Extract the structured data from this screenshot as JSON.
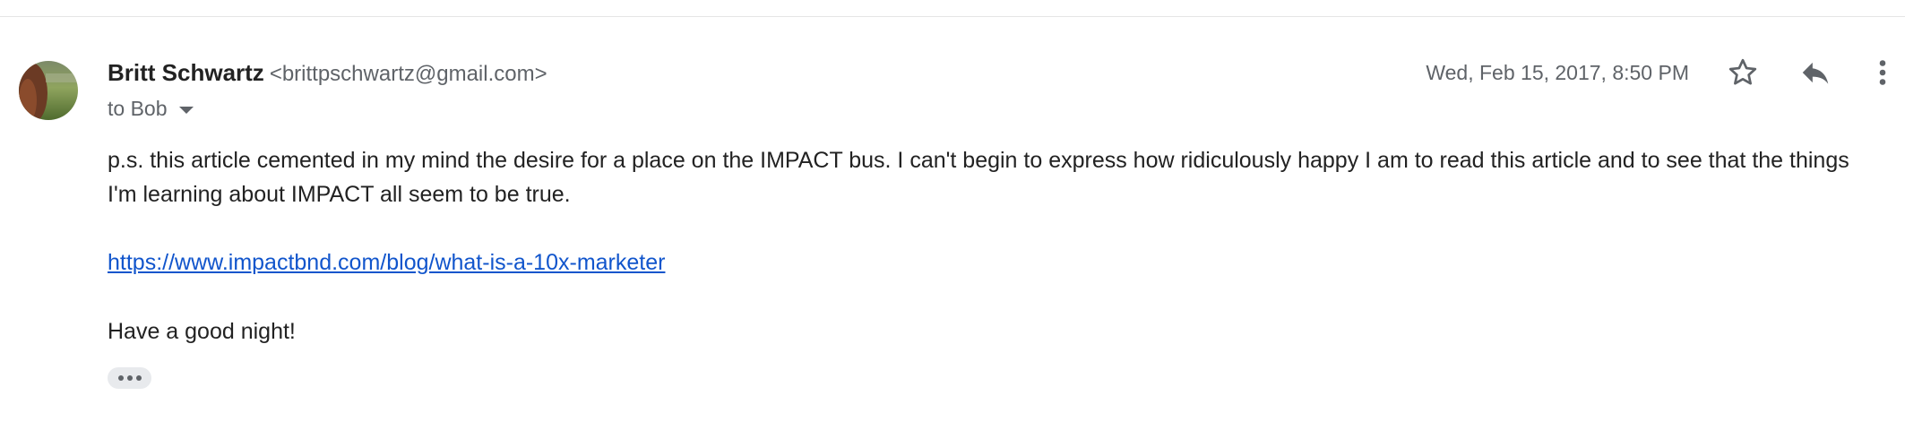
{
  "message": {
    "sender": {
      "name": "Britt Schwartz",
      "email": "<brittpschwartz@gmail.com>"
    },
    "recipient_text": "to Bob",
    "timestamp": "Wed, Feb 15, 2017, 8:50 PM",
    "body": {
      "paragraph_1": "p.s. this article cemented in my mind the desire for a place on the IMPACT bus. I can't begin to express how ridiculously happy I am to read this article and to see that the things I'm learning about IMPACT all seem to be true.",
      "link_text": "https://www.impactbnd.com/blog/what-is-a-10x-marketer",
      "closing": "Have a good night!"
    }
  },
  "icons": {
    "star": "star-icon",
    "reply": "reply-icon",
    "more": "more-vert-icon",
    "details": "chevron-down-icon",
    "trimmed": "ellipsis-icon"
  },
  "colors": {
    "link": "#1155cc",
    "secondary_text": "#5f6368",
    "primary_text": "#222222"
  }
}
